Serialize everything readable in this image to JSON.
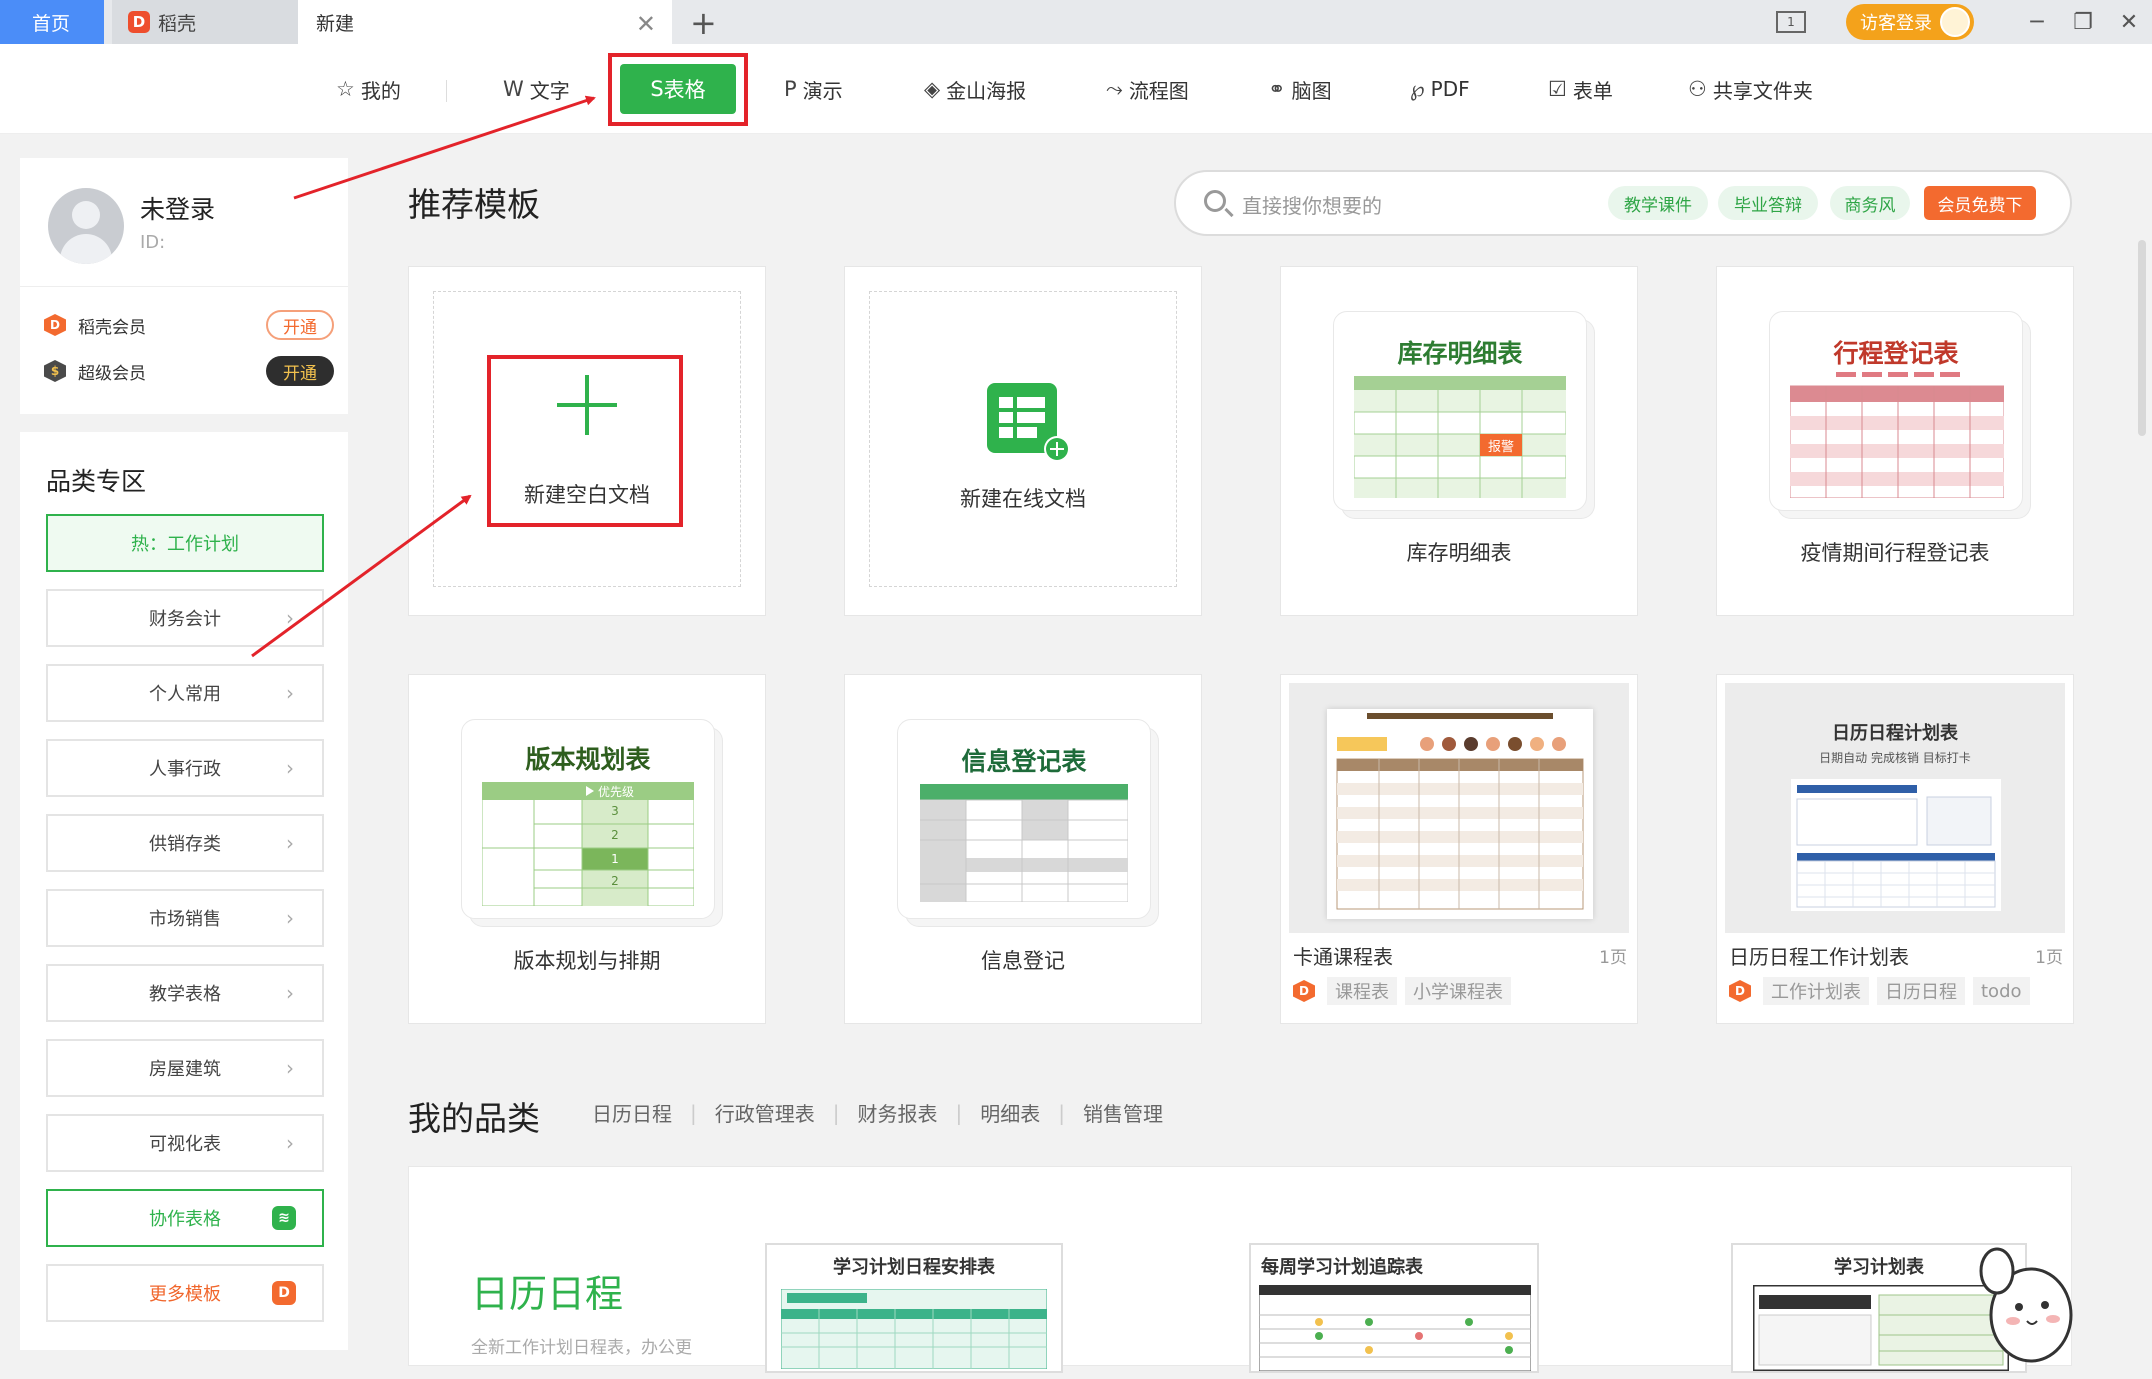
{
  "tabs": {
    "home": "首页",
    "daoke": "稻壳",
    "new": "新建"
  },
  "titlebar": {
    "visitor_login": "访客登录"
  },
  "nav": {
    "items": [
      "我的",
      "文字",
      "表格",
      "演示",
      "金山海报",
      "流程图",
      "脑图",
      "PDF",
      "表单",
      "共享文件夹"
    ],
    "active": "表格"
  },
  "profile": {
    "name": "未登录",
    "id": "ID:",
    "daoke_vip": "稻壳会员",
    "super_vip": "超级会员",
    "open": "开通",
    "open_dark": "开通"
  },
  "category": {
    "title": "品类专区",
    "hot": "热：工作计划",
    "items": [
      "财务会计",
      "个人常用",
      "人事行政",
      "供销存类",
      "市场销售",
      "教学表格",
      "房屋建筑",
      "可视化表"
    ],
    "collab": "协作表格",
    "more": "更多模板"
  },
  "recommend": {
    "title": "推荐模板",
    "search_placeholder": "直接搜你想要的",
    "search_tags": [
      "教学课件",
      "毕业答辩",
      "商务风"
    ],
    "vip_free": "会员免费下"
  },
  "cards": {
    "blank": "新建空白文档",
    "online": "新建在线文档",
    "inventory_thumb": "库存明细表",
    "inventory": "库存明细表",
    "inventory_alert": "报警",
    "trip_thumb": "行程登记表",
    "trip": "疫情期间行程登记表",
    "version_thumb": "版本规划表",
    "version_priority": "优先级",
    "version_levels": [
      "3",
      "2",
      "1",
      "2"
    ],
    "version": "版本规划与排期",
    "info_thumb": "信息登记表",
    "info": "信息登记",
    "cartoon_title": "卡通课程表",
    "cartoon_pages": "1页",
    "cartoon_tags": [
      "课程表",
      "小学课程表"
    ],
    "calendar_thumb_title": "日历日程计划表",
    "calendar_thumb_sub": "日期自动  完成核销  目标打卡",
    "calendar_title": "日历日程工作计划表",
    "calendar_pages": "1页",
    "calendar_tags": [
      "工作计划表",
      "日历日程",
      "todo"
    ]
  },
  "mycat": {
    "title": "我的品类",
    "tabs": [
      "日历日程",
      "行政管理表",
      "财务报表",
      "明细表",
      "销售管理"
    ],
    "panel_title": "日历日程",
    "panel_sub": "全新工作计划日程表，办公更",
    "thumbs": [
      "学习计划日程安排表",
      "每周学习计划追踪表",
      "学习计划表"
    ]
  },
  "colors": {
    "green": "#2fb24c",
    "red": "#e3232a",
    "orange": "#f36a2f",
    "blue": "#4b8df8"
  }
}
